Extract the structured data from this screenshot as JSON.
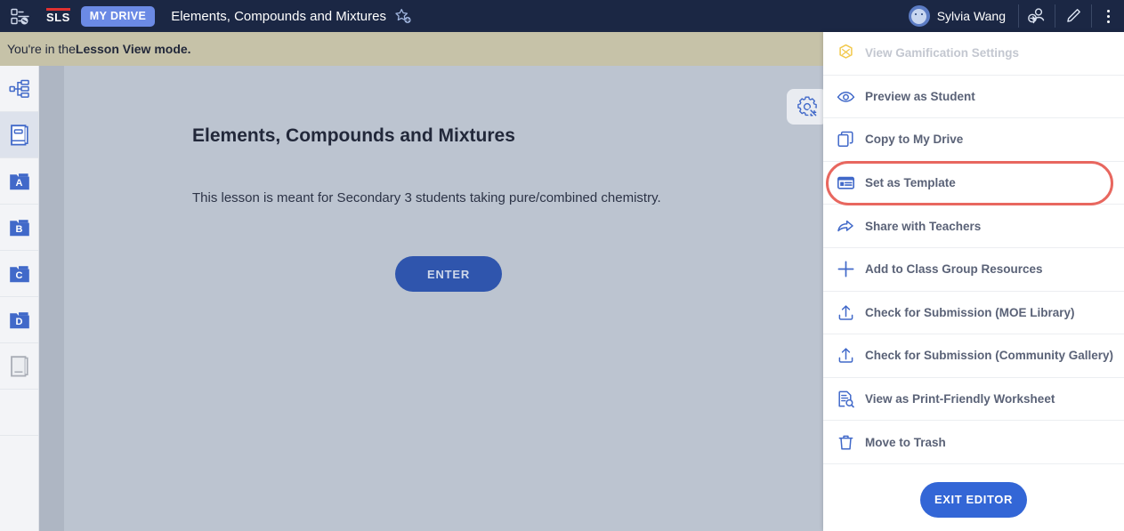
{
  "topbar": {
    "menu_icon": "hamburger-sitemap-icon",
    "logo_text": "SLS",
    "drive_badge": "MY DRIVE",
    "doc_title": "Elements, Compounds and Mixtures",
    "star_icon": "star-add-icon",
    "user_name": "Sylvia Wang",
    "avatar_icon": "avatar",
    "switch_user_icon": "person-switch-icon",
    "edit_icon": "pencil-icon",
    "overflow_icon": "kebab-menu-icon"
  },
  "notice": {
    "prefix": "You're in the ",
    "emphasis": "Lesson View mode."
  },
  "sidebar": {
    "items": [
      {
        "name": "sitemap-icon",
        "label": "",
        "icon": "sitemap-icon",
        "active": false
      },
      {
        "name": "lesson-book-icon",
        "label": "",
        "icon": "book-icon",
        "active": true
      },
      {
        "name": "folder-a",
        "label": "A",
        "icon": "folder-icon",
        "active": false
      },
      {
        "name": "folder-b",
        "label": "B",
        "icon": "folder-icon",
        "active": false
      },
      {
        "name": "folder-c",
        "label": "C",
        "icon": "folder-icon",
        "active": false
      },
      {
        "name": "folder-d",
        "label": "D",
        "icon": "folder-icon",
        "active": false
      },
      {
        "name": "notes-book",
        "label": "",
        "icon": "book-gray-icon",
        "active": false
      }
    ]
  },
  "content": {
    "settings_icon": "gear-collapse-icon",
    "title": "Elements, Compounds and Mixtures",
    "description": "This lesson is meant for Secondary 3 students taking pure/combined chemistry.",
    "enter_button": "ENTER"
  },
  "menu": {
    "items": [
      {
        "label": "View Gamification Settings",
        "icon": "gem-icon",
        "disabled": true,
        "highlighted": false
      },
      {
        "label": "Preview as Student",
        "icon": "eye-icon",
        "disabled": false,
        "highlighted": false
      },
      {
        "label": "Copy to My Drive",
        "icon": "copy-icon",
        "disabled": false,
        "highlighted": false
      },
      {
        "label": "Set as Template",
        "icon": "template-icon",
        "disabled": false,
        "highlighted": true
      },
      {
        "label": "Share with Teachers",
        "icon": "share-arrow-icon",
        "disabled": false,
        "highlighted": false
      },
      {
        "label": "Add to Class Group Resources",
        "icon": "plus-icon",
        "disabled": false,
        "highlighted": false
      },
      {
        "label": "Check for Submission (MOE Library)",
        "icon": "upload-icon",
        "disabled": false,
        "highlighted": false
      },
      {
        "label": "Check for Submission (Community Gallery)",
        "icon": "upload-icon",
        "disabled": false,
        "highlighted": false
      },
      {
        "label": "View as Print-Friendly Worksheet",
        "icon": "document-search-icon",
        "disabled": false,
        "highlighted": false
      },
      {
        "label": "Move to Trash",
        "icon": "trash-icon",
        "disabled": false,
        "highlighted": false
      }
    ],
    "exit_button": "EXIT EDITOR"
  },
  "colors": {
    "topbar_bg": "#1b2744",
    "notice_bg": "#c6c2a8",
    "canvas_bg": "#bcc4d0",
    "accent_blue": "#3366d6",
    "enter_blue": "#2f55ad",
    "highlight_red": "#e8675f",
    "badge_blue": "#6b8ae5",
    "icon_blue": "#4169c9",
    "gem_yellow": "#f2c94c"
  }
}
